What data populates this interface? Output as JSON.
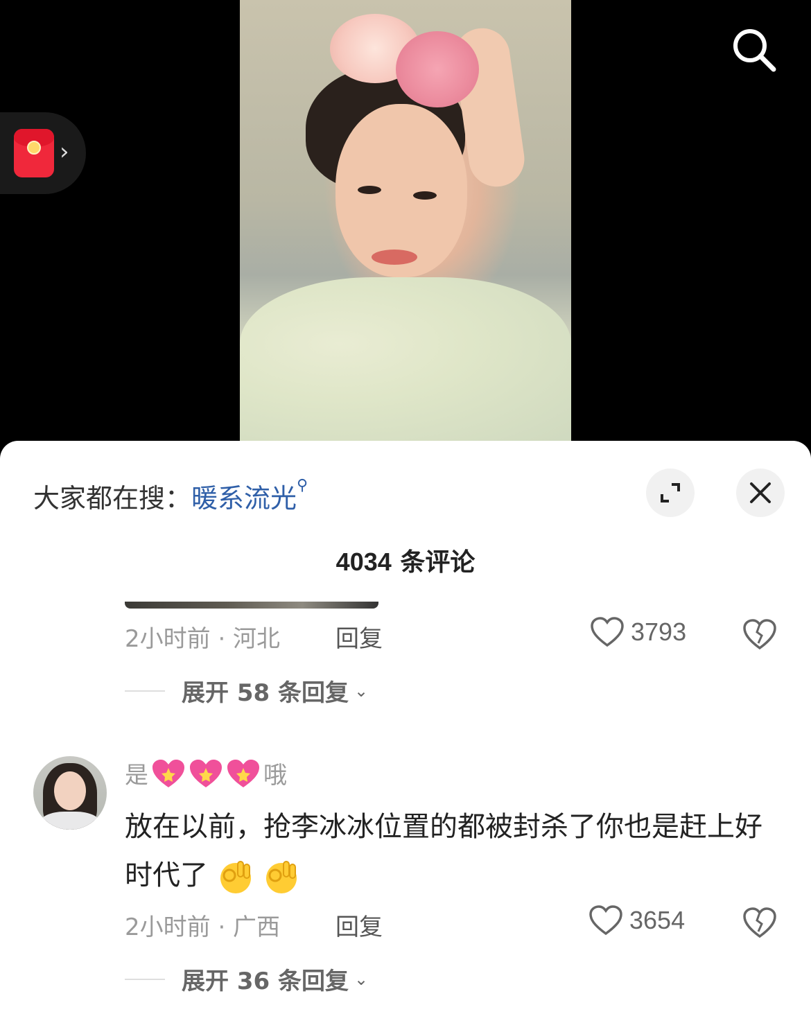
{
  "hot_search": {
    "prefix": "大家都在搜：",
    "keyword": "暖系流光"
  },
  "comments_count": {
    "number": "4034",
    "suffix": "条评论"
  },
  "comment1": {
    "meta": "2小时前 · 河北",
    "reply_label": "回复",
    "likes": "3793",
    "expand_label": "展开 58 条回复"
  },
  "comment2": {
    "username_start": "是",
    "username_end": "哦",
    "text": "放在以前，抢李冰冰位置的都被封杀了你也是赶上好时代了",
    "meta": "2小时前 · 广西",
    "reply_label": "回复",
    "likes": "3654",
    "expand_label": "展开 36 条回复"
  },
  "colors": {
    "keyword_blue": "#2f5fa8",
    "red_packet": "#f0283b"
  },
  "icons": [
    "search-icon",
    "red-packet-icon",
    "expand-icon",
    "close-icon",
    "heart-icon",
    "broken-heart-icon",
    "chevron-down-icon",
    "sparkling-heart-emoji",
    "ok-hand-emoji"
  ]
}
